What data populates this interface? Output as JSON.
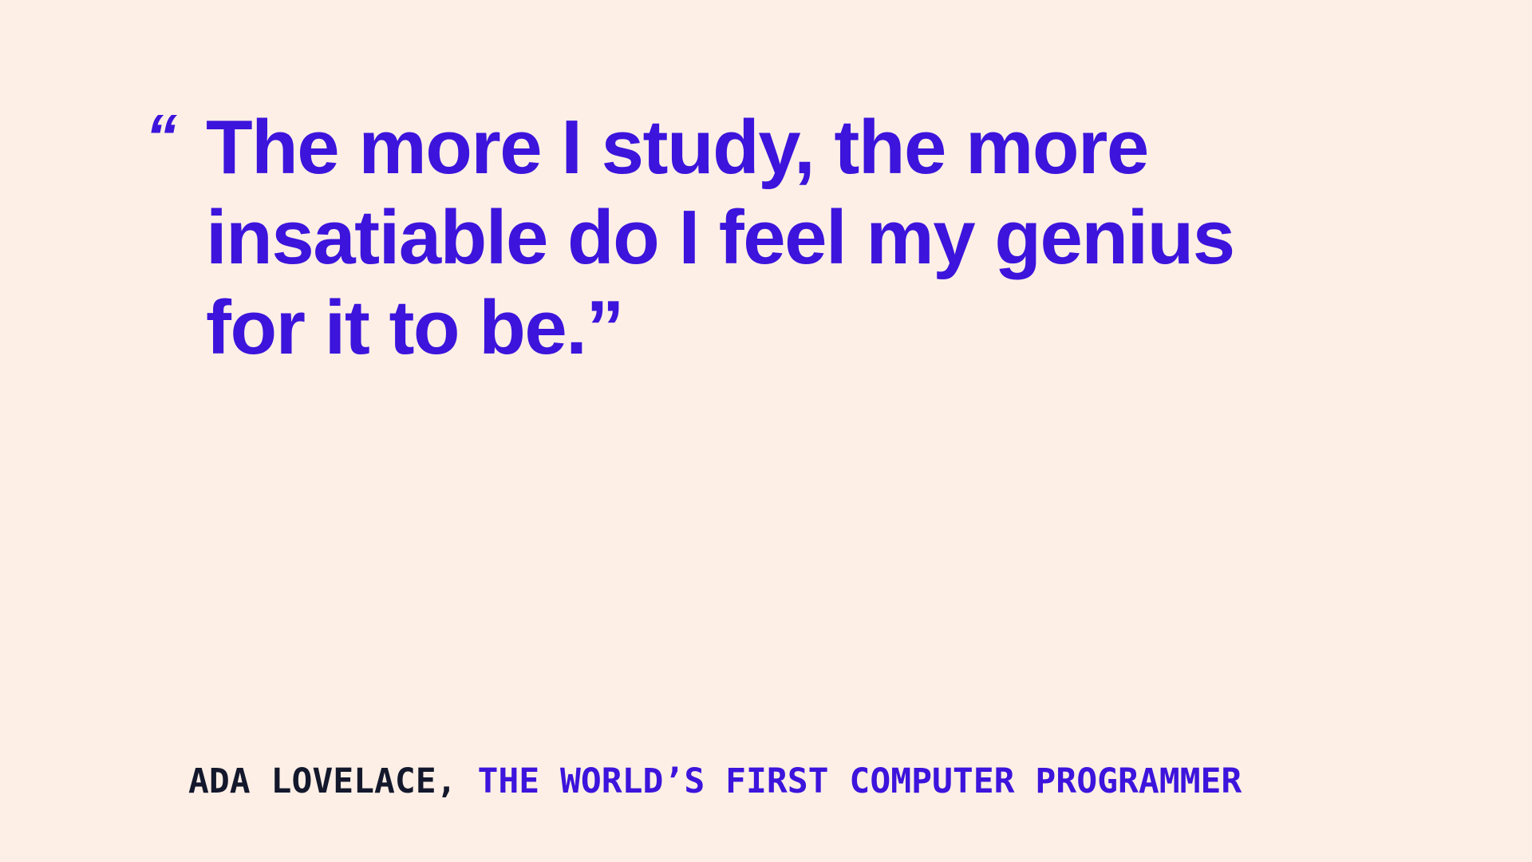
{
  "quote": {
    "open_mark": "“",
    "text": "The more I study, the more insatiable do I feel my genius for it to be.”"
  },
  "attribution": {
    "author": "ADA LOVELACE,",
    "role": "THE WORLD’S FIRST COMPUTER PROGRAMMER"
  },
  "colors": {
    "background": "#fdefe6",
    "accent": "#3c14dc",
    "author": "#14182c"
  }
}
